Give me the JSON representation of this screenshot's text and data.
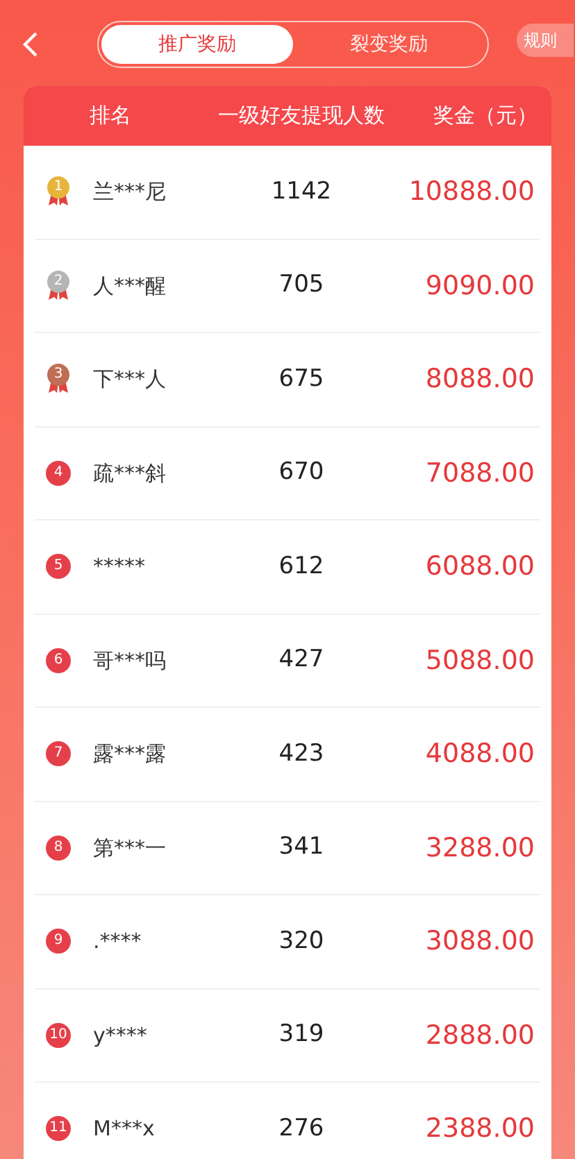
{
  "tabs": [
    {
      "label": "推广奖励",
      "selected": true
    },
    {
      "label": "裂变奖励",
      "selected": false
    }
  ],
  "rules_button": "规则",
  "table": {
    "columns": [
      "排名",
      "一级好友提现人数",
      "奖金（元）"
    ],
    "rows": [
      {
        "rank": "1",
        "kind": "medal",
        "color": "#e7b53c",
        "name": "兰***尼",
        "count": "1142",
        "amount": "10888.00"
      },
      {
        "rank": "2",
        "kind": "medal",
        "color": "#b5b5b5",
        "name": "人***醒",
        "count": "705",
        "amount": "9090.00"
      },
      {
        "rank": "3",
        "kind": "medal",
        "color": "#c06e55",
        "name": "下***人",
        "count": "675",
        "amount": "8088.00"
      },
      {
        "rank": "4",
        "kind": "circle",
        "name": "疏***斜",
        "count": "670",
        "amount": "7088.00"
      },
      {
        "rank": "5",
        "kind": "circle",
        "name": "*****",
        "count": "612",
        "amount": "6088.00"
      },
      {
        "rank": "6",
        "kind": "circle",
        "name": "哥***吗",
        "count": "427",
        "amount": "5088.00"
      },
      {
        "rank": "7",
        "kind": "circle",
        "name": "露***露",
        "count": "423",
        "amount": "4088.00"
      },
      {
        "rank": "8",
        "kind": "circle",
        "name": "第***一",
        "count": "341",
        "amount": "3288.00"
      },
      {
        "rank": "9",
        "kind": "circle",
        "name": ".****",
        "count": "320",
        "amount": "3088.00"
      },
      {
        "rank": "10",
        "kind": "circle",
        "name": "y****",
        "count": "319",
        "amount": "2888.00"
      },
      {
        "rank": "11",
        "kind": "circle",
        "name": "M***x",
        "count": "276",
        "amount": "2388.00"
      }
    ]
  }
}
